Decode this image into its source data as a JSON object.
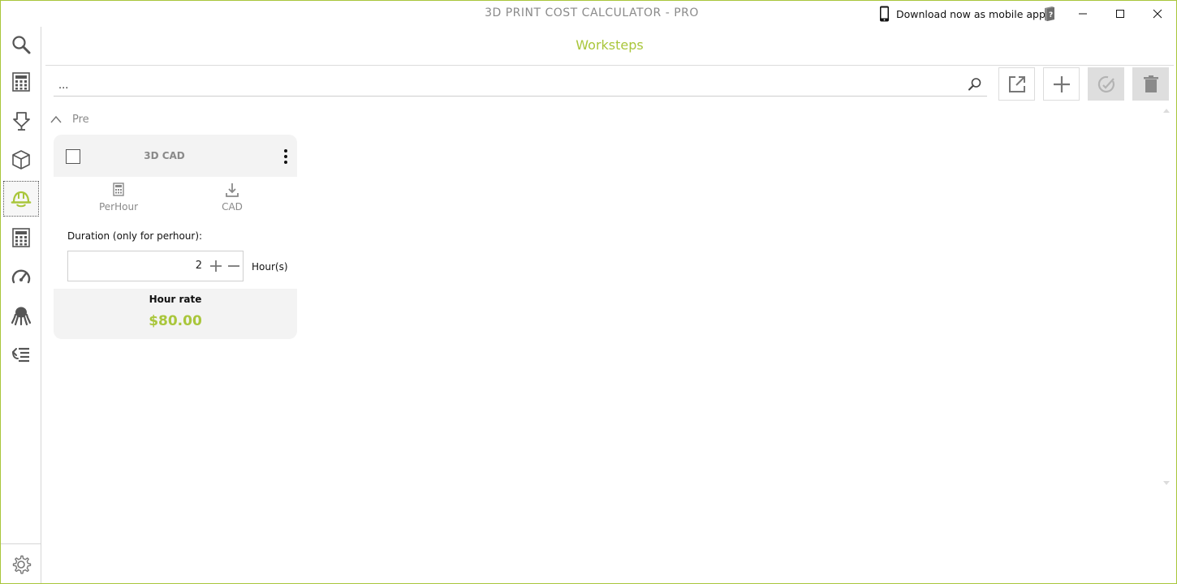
{
  "window": {
    "title": "3D PRINT COST CALCULATOR - PRO",
    "mobile_link": "Download now as mobile app!"
  },
  "sidebar": {
    "items": [
      {
        "icon": "search-icon"
      },
      {
        "icon": "calculator-icon"
      },
      {
        "icon": "printer-icon"
      },
      {
        "icon": "cube-icon"
      },
      {
        "icon": "hardhat-icon",
        "active": true
      },
      {
        "icon": "grid-icon"
      },
      {
        "icon": "gauge-icon"
      },
      {
        "icon": "octopus-icon"
      },
      {
        "icon": "list-icon"
      }
    ],
    "settings_icon": "gear-icon"
  },
  "header": {
    "title": "Worksteps"
  },
  "search": {
    "value": "..."
  },
  "groups": [
    {
      "label": "Pre",
      "expanded": true,
      "cards": [
        {
          "title": "3D CAD",
          "checked": false,
          "props": [
            {
              "label": "PerHour",
              "icon": "calculator-icon"
            },
            {
              "label": "CAD",
              "icon": "download-icon"
            }
          ],
          "duration_label": "Duration (only for perhour):",
          "duration_value": "2",
          "unit": "Hour(s)",
          "rate_label": "Hour rate",
          "rate_value": "$80.00"
        }
      ]
    }
  ],
  "colors": {
    "accent": "#a9c63b",
    "border": "#a9c63b",
    "muted_text": "#8a8a8a"
  }
}
